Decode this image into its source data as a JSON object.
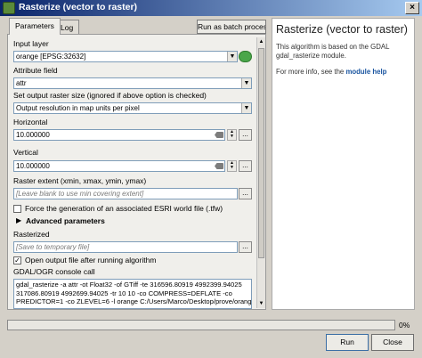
{
  "window": {
    "title": "Rasterize (vector to raster)",
    "close_glyph": "×",
    "icon": "qgis-icon"
  },
  "tabs": [
    {
      "label": "Parameters",
      "active": true
    },
    {
      "label": "Log",
      "active": false
    }
  ],
  "batch_button": "Run as batch process...",
  "params": {
    "input_layer": {
      "label": "Input layer",
      "value": "orange [EPSG:32632]"
    },
    "attribute_field": {
      "label": "Attribute field",
      "value": "attr"
    },
    "output_size": {
      "label": "Set output raster size (ignored if above option is checked)",
      "value": "Output resolution in map units per pixel"
    },
    "horizontal": {
      "label": "Horizontal",
      "value": "10.000000"
    },
    "vertical": {
      "label": "Vertical",
      "value": "10.000000"
    },
    "raster_extent": {
      "label": "Raster extent (xmin, xmax, ymin, ymax)",
      "placeholder": "[Leave blank to use min covering extent]"
    },
    "force_world_file": {
      "label": "Force the generation of an associated ESRI world file (.tfw)",
      "checked": false
    },
    "advanced": {
      "label": "Advanced parameters"
    },
    "rasterized": {
      "label": "Rasterized",
      "placeholder": "[Save to temporary file]"
    },
    "open_output": {
      "label": "Open output file after running algorithm",
      "checked": true
    },
    "console": {
      "label": "GDAL/OGR console call",
      "lines": [
        "gdal_rasterize -a attr -ot Float32 -of GTiff -te 316596.80919 4992399.94025",
        "317086.80919 4992699.94025 -tr 10 10 -co COMPRESS=DEFLATE -co",
        "PREDICTOR=1 -co ZLEVEL=6 -l orange C:/Users/Marco/Desktop/prove/orange.shp"
      ]
    },
    "browse_label": "..."
  },
  "help": {
    "title": "Rasterize (vector to raster)",
    "text": "This algorithm is based on the GDAL gdal_rasterize module.",
    "more_prefix": "For more info, see the",
    "more_link": "module help"
  },
  "progress": {
    "value": 0,
    "label": "0%"
  },
  "buttons": {
    "run": "Run",
    "close": "Close"
  },
  "colors": {
    "title_start": "#0a246a",
    "title_end": "#a6caf0",
    "link": "#1a55a0"
  }
}
